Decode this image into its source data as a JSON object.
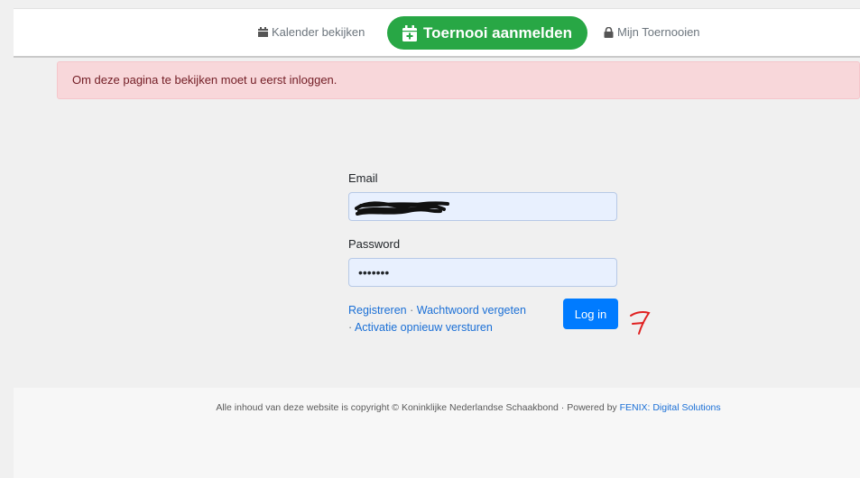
{
  "nav": {
    "calendar_label": "Kalender bekijken",
    "register_label": "Toernooi aanmelden",
    "my_tournaments_label": "Mijn Toernooien"
  },
  "alert": {
    "text": "Om deze pagina te bekijken moet u eerst inloggen."
  },
  "login": {
    "email_label": "Email",
    "password_label": "Password",
    "password_value": "•••••••",
    "register_link": "Registreren",
    "forgot_link": "Wachtwoord vergeten",
    "resend_link": "Activatie opnieuw versturen",
    "separator": "·",
    "login_button": "Log in"
  },
  "footer": {
    "text": "Alle inhoud van deze website is copyright © Koninklijke Nederlandse Schaakbond · Powered by",
    "link": "FENIX: Digital Solutions"
  },
  "colors": {
    "active_nav": "#28a745",
    "alert_bg": "#f8d7da",
    "primary": "#007bff",
    "link": "#1a6fd6",
    "annotation": "#e02020"
  },
  "icons": {
    "calendar": "calendar-icon",
    "calendar_plus": "calendar-plus-icon",
    "lock": "lock-icon"
  }
}
